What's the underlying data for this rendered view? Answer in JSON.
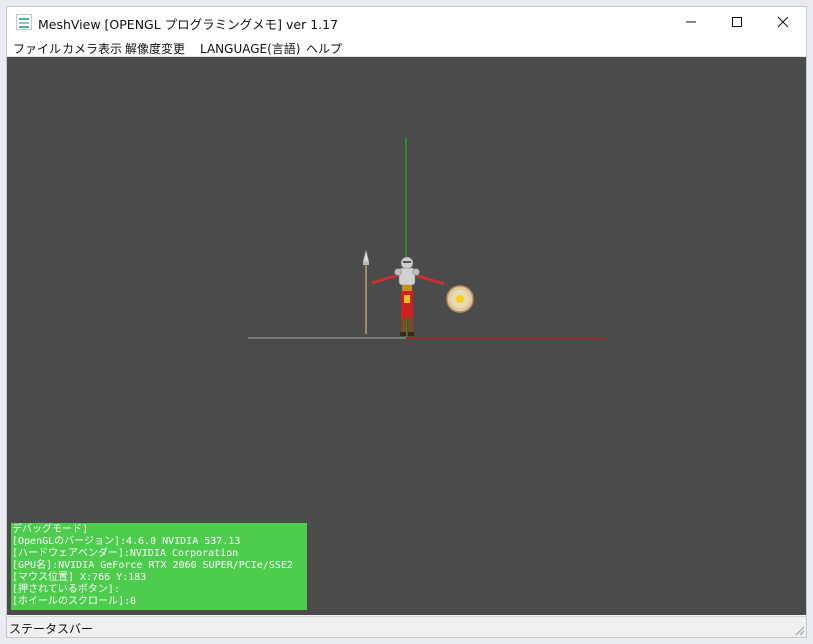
{
  "window": {
    "title": "MeshView [OPENGL プログラミングメモ] ver 1.17"
  },
  "menu": {
    "items": [
      "ファイル",
      "カメラ表示",
      "解像度変更",
      "LANGUAGE(言語)",
      "ヘルプ"
    ]
  },
  "icons": {
    "app": "meshview-app-icon",
    "minimize": "minimize-icon",
    "maximize": "maximize-icon",
    "close": "close-icon",
    "grip": "resize-grip-icon"
  },
  "colors": {
    "viewport_bg": "#4b4b4b",
    "debug_bg": "#4dcc4d",
    "axis_y": "#18c418",
    "axis_x": "#b21c1c",
    "ground": "#a9a9a9"
  },
  "debug": {
    "lines": [
      "デバッグモード]",
      "[OpenGLのバージョン]:4.6.0 NVIDIA 537.13",
      "[ハードウェアベンダー]:NVIDIA Corporation",
      "[GPU名]:NVIDIA GeForce RTX 2060 SUPER/PCIe/SSE2",
      "[マウス位置] X:766 Y:183",
      "[押されているボタン]:",
      "[ホイールのスクロール]:0"
    ]
  },
  "status": {
    "text": "ステータスバー"
  }
}
